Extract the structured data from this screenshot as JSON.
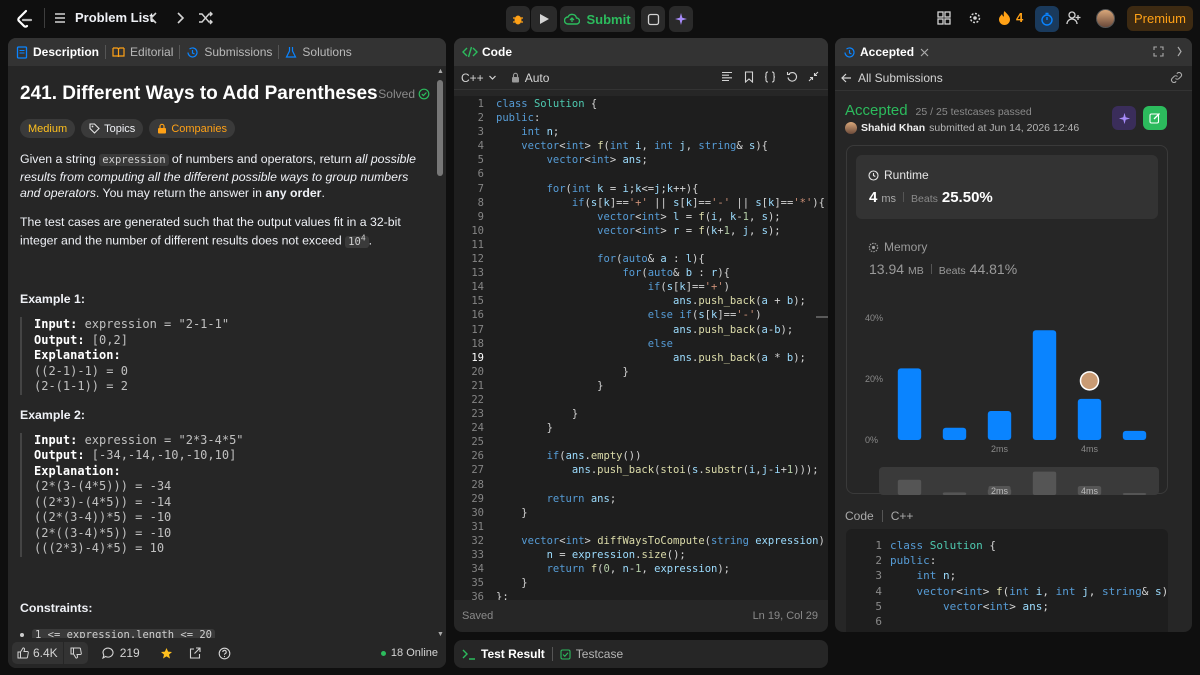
{
  "nav": {
    "problem_list": "Problem List",
    "submit": "Submit",
    "streak": "4",
    "premium": "Premium"
  },
  "desc": {
    "tabs": [
      "Description",
      "Editorial",
      "Submissions",
      "Solutions"
    ],
    "title": "241. Different Ways to Add Parentheses",
    "solved": "Solved",
    "tags": [
      "Medium",
      "Topics",
      "Companies"
    ],
    "p1_a": "Given a string ",
    "p1_code": "expression",
    "p1_b": " of numbers and operators, return ",
    "p1_em": "all possible results from computing all the different possible ways to group numbers and operators",
    "p1_c": ". You may return the answer in ",
    "p1_strong": "any order",
    "p1_d": ".",
    "p2": "The test cases are generated such that the output values fit in a 32-bit integer and the number of different results does not exceed ",
    "p2_code": "10",
    "p2_sup": "4",
    "p2_end": ".",
    "ex1_title": "Example 1:",
    "ex1_input_label": "Input:",
    "ex1_input": " expression = \"2-1-1\"",
    "ex1_output_label": "Output:",
    "ex1_output": " [0,2]",
    "ex1_expl_label": "Explanation:",
    "ex1_lines": [
      "((2-1)-1) = 0",
      "(2-(1-1)) = 2"
    ],
    "ex2_title": "Example 2:",
    "ex2_input_label": "Input:",
    "ex2_input": " expression = \"2*3-4*5\"",
    "ex2_output_label": "Output:",
    "ex2_output": " [-34,-14,-10,-10,10]",
    "ex2_expl_label": "Explanation:",
    "ex2_lines": [
      "(2*(3-(4*5))) = -34",
      "((2*3)-(4*5)) = -14",
      "((2*(3-4))*5) = -10",
      "(2*((3-4)*5)) = -10",
      "(((2*3)-4)*5) = 10"
    ],
    "constraints_title": "Constraints:",
    "constraint1": "1 <= expression.length <= 20",
    "likes": "6.4K",
    "comments": "219",
    "online": "18 Online"
  },
  "code": {
    "title": "Code",
    "lang": "C++",
    "mode": "Auto",
    "status": "Saved",
    "cursor": "Ln 19, Col 29",
    "lines": [
      "class Solution {",
      "public:",
      "    int n;",
      "    vector<int> f(int i, int j, string& s){",
      "        vector<int> ans;",
      "",
      "        for(int k = i;k<=j;k++){",
      "            if(s[k]=='+' || s[k]=='-' || s[k]=='*'){",
      "                vector<int> l = f(i, k-1, s);",
      "                vector<int> r = f(k+1, j, s);",
      "",
      "                for(auto& a : l){",
      "                    for(auto& b : r){",
      "                        if(s[k]=='+')",
      "                            ans.push_back(a + b);",
      "                        else if(s[k]=='-')",
      "                            ans.push_back(a-b);",
      "                        else",
      "                            ans.push_back(a * b);",
      "                    }",
      "                }",
      "",
      "            }",
      "        }",
      "",
      "        if(ans.empty())",
      "            ans.push_back(stoi(s.substr(i,j-i+1)));",
      "",
      "        return ans;",
      "    }",
      "",
      "    vector<int> diffWaysToCompute(string expression) {",
      "        n = expression.size();",
      "        return f(0, n-1, expression);",
      "    }",
      "};"
    ],
    "line_numbers": [
      "1",
      "2",
      "3",
      "4",
      "5",
      "6",
      "7",
      "8",
      "9",
      "10",
      "11",
      "12",
      "13",
      "14",
      "15",
      "16",
      "17",
      "18",
      "19",
      "20",
      "21",
      "22",
      "23",
      "24",
      "25",
      "26",
      "27",
      "28",
      "29",
      "30",
      "31",
      "32",
      "33",
      "34",
      "35",
      "36"
    ]
  },
  "result": {
    "tab": "Accepted",
    "all_submissions": "All Submissions",
    "status": "Accepted",
    "testcases": "25 / 25 testcases passed",
    "user": "Shahid Khan",
    "submitted": "submitted at Jun 14, 2026 12:46",
    "runtime_label": "Runtime",
    "runtime_value": "4",
    "runtime_unit": "ms",
    "beats_label": "Beats",
    "runtime_beats": "25.50%",
    "memory_label": "Memory",
    "memory_value": "13.94",
    "memory_unit": "MB",
    "memory_beats": "44.81%",
    "code_label": "Code",
    "code_lang": "C++",
    "preview_lines": [
      "class Solution {",
      "public:",
      "    int n;",
      "    vector<int> f(int i, int j, string& s){",
      "        vector<int> ans;",
      ""
    ],
    "preview_numbers": [
      "1",
      "2",
      "3",
      "4",
      "5",
      "6"
    ]
  },
  "bottom": {
    "test_result": "Test Result",
    "testcase": "Testcase"
  },
  "colors": {
    "accent_orange": "#ffa116",
    "green": "#2cbb5d",
    "bar_blue": "#0a84ff",
    "panel": "#262626",
    "header": "#333333"
  },
  "chart_data": {
    "type": "bar",
    "x_ticks": [
      "2ms",
      "4ms"
    ],
    "y_ticks": [
      "40%",
      "20%",
      "0%"
    ],
    "ylim": [
      0,
      40
    ],
    "categories": [
      "0ms",
      "1ms",
      "2ms",
      "3ms",
      "4ms",
      "5ms"
    ],
    "values": [
      23.5,
      4,
      9.5,
      36,
      13.5,
      3
    ],
    "highlight": "4ms"
  }
}
